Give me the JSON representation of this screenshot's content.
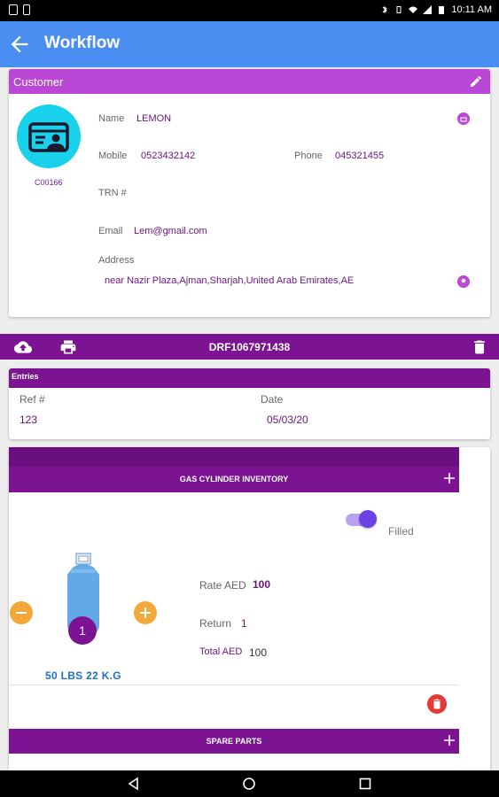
{
  "status_bar": {
    "time": "10:11 AM"
  },
  "app_bar": {
    "title": "Workflow",
    "back_icon": "arrow-left-icon"
  },
  "customer": {
    "header_label": "Customer",
    "code": "C00166",
    "name_label": "Name",
    "name": "LEMON",
    "mobile_label": "Mobile",
    "mobile": "0523432142",
    "phone_label": "Phone",
    "phone": "045321455",
    "trn_label": "TRN #",
    "trn": "",
    "email_label": "Email",
    "email": "Lem@gmail.com",
    "address_label": "Address",
    "address": "near Nazir Plaza,Ajman,Sharjah,United Arab Emirates,AE"
  },
  "toolbar": {
    "doc_number": "DRF1067971438"
  },
  "entries": {
    "header_label": "Entries",
    "ref_label": "Ref #",
    "ref_value": "123",
    "date_label": "Date",
    "date_value": "05/03/20"
  },
  "inventory": {
    "section_title": "GAS CYLINDER INVENTORY",
    "filled_label": "Filled",
    "filled_on": true,
    "quantity": "1",
    "size_label": "50 LBS 22 K.G",
    "rate_label": "Rate AED",
    "rate_value": "100",
    "return_label": "Return",
    "return_value": "1",
    "total_label": "Total AED",
    "total_value": "100",
    "spare_title": "SPARE PARTS"
  },
  "colors": {
    "app_bar": "#4a8ef1",
    "customer_header": "#bb47d6",
    "accent_purple": "#7b1392",
    "avatar_bg": "#19d1ea",
    "stepper": "#f4a83a",
    "delete": "#e53935",
    "size_text": "#1e6fc7"
  }
}
